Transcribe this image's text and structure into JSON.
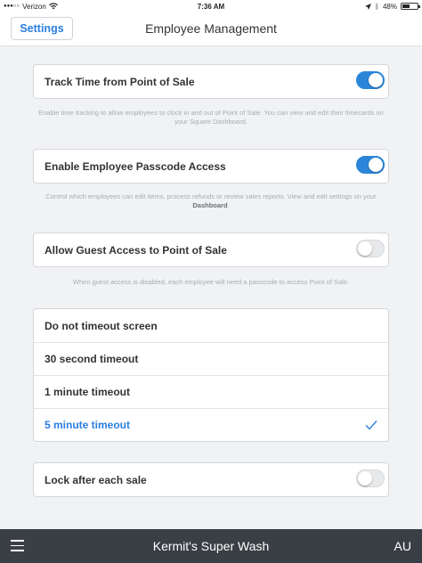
{
  "status_bar": {
    "carrier": "Verizon",
    "time": "7:36 AM",
    "battery_text": "48%",
    "battery_level": 0.48
  },
  "nav": {
    "back_label": "Settings",
    "title": "Employee Management"
  },
  "track_time": {
    "label": "Track Time from Point of Sale",
    "enabled": true,
    "hint": "Enable time tracking to allow employees to clock in and out of Point of Sale. You can view and edit their timecards on your Square Dashboard."
  },
  "passcode": {
    "label": "Enable Employee Passcode Access",
    "enabled": true,
    "hint_part1": "Control which employees can edit items, process refunds or review sales reports. View and edit settings on your ",
    "hint_link": "Dashboard",
    "hint_part2": "."
  },
  "guest": {
    "label": "Allow Guest Access to Point of Sale",
    "enabled": false,
    "hint": "When guest access is disabled, each employee will need a passcode to access Point of Sale."
  },
  "timeout": {
    "options": [
      "Do not timeout screen",
      "30 second timeout",
      "1 minute timeout",
      "5 minute timeout"
    ],
    "selected": "5 minute timeout"
  },
  "lock": {
    "label": "Lock after each sale",
    "enabled": false
  },
  "bottom_bar": {
    "business_name": "Kermit's Super Wash",
    "initials": "AU"
  },
  "colors": {
    "accent": "#2b7fe0",
    "toggle_on": "#2b86d9",
    "bottom_bar": "#3a3f45"
  }
}
